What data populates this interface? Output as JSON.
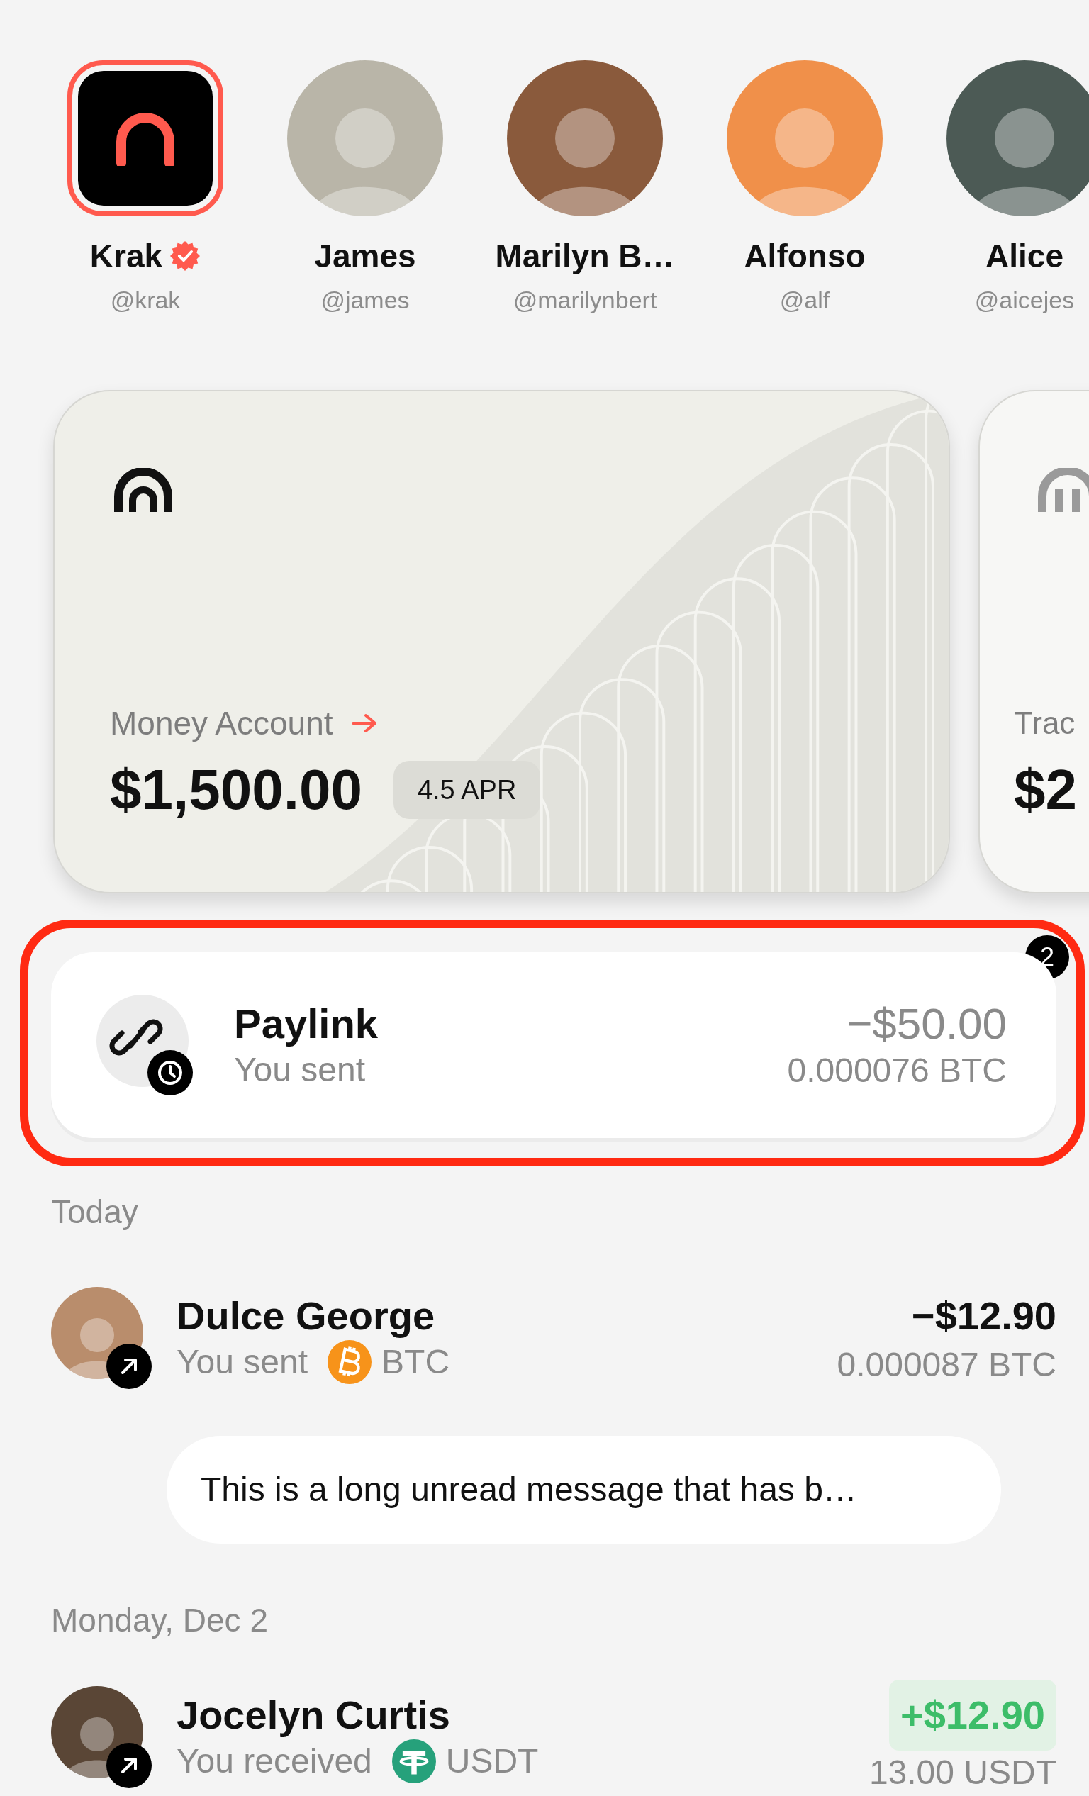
{
  "contacts": [
    {
      "kind": "brand",
      "name": "Krak",
      "handle": "@krak",
      "verified": true,
      "selected": true
    },
    {
      "kind": "person",
      "name": "James",
      "handle": "@james",
      "verified": false,
      "selected": false
    },
    {
      "kind": "person",
      "name": "Marilyn B…",
      "handle": "@marilynbert",
      "verified": false,
      "selected": false
    },
    {
      "kind": "person",
      "name": "Alfonso",
      "handle": "@alf",
      "verified": false,
      "selected": false
    },
    {
      "kind": "person",
      "name": "Alice",
      "handle": "@aicejes",
      "verified": false,
      "selected": false
    }
  ],
  "cards": [
    {
      "kind": "money",
      "label": "Money Account",
      "link": true,
      "balance": "$1,500.00",
      "apr": "4.5 APR"
    },
    {
      "kind": "trading",
      "label": "Trac",
      "link": false,
      "balance": "$2"
    }
  ],
  "paylink": {
    "title": "Paylink",
    "subtitle": "You sent",
    "amount": "−$50.00",
    "crypto": "0.000076 BTC",
    "badge": "2",
    "highlighted": true
  },
  "sections": [
    {
      "heading": "Today",
      "transactions": [
        {
          "kind": "out",
          "name": "Dulce George",
          "subtitle": "You sent",
          "coin": {
            "kind": "btc",
            "label": "BTC"
          },
          "amount": "−$12.90",
          "crypto": "0.000087 BTC",
          "message": "This is a long unread message that has b…"
        }
      ]
    },
    {
      "heading": "Monday, Dec 2",
      "transactions": [
        {
          "kind": "in",
          "name": "Jocelyn Curtis",
          "subtitle": "You received",
          "coin": {
            "kind": "usdt",
            "label": "USDT"
          },
          "amount": "+$12.90",
          "crypto": "13.00 USDT"
        }
      ]
    }
  ]
}
